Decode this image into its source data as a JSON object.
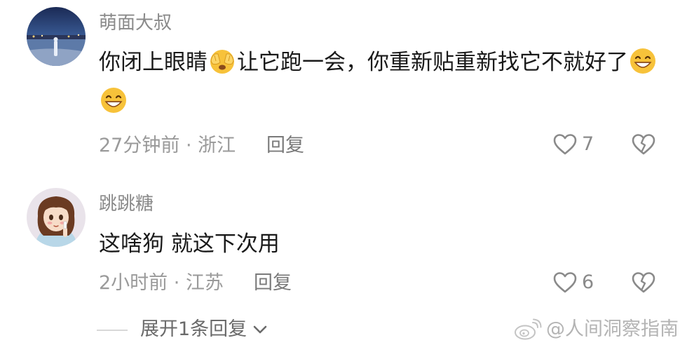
{
  "comments": [
    {
      "username": "萌面大叔",
      "text_part1": "你闭上眼睛",
      "text_part2": "让它跑一会，你重新贴重新找它不就好了",
      "time": "27分钟前",
      "separator": "·",
      "location": "浙江",
      "reply_label": "回复",
      "likes": "7",
      "avatar_icon": "night-city-avatar",
      "emojis": [
        "face-covering-eyes-emoji",
        "grinning-emoji",
        "grinning-emoji"
      ]
    },
    {
      "username": "跳跳糖",
      "text": "这啥狗 就这下次用",
      "time": "2小时前",
      "separator": "·",
      "location": "江苏",
      "reply_label": "回复",
      "likes": "6",
      "avatar_icon": "anime-girl-avatar"
    }
  ],
  "expand_replies_label": "展开1条回复",
  "watermark": "@人间洞察指南",
  "colors": {
    "username": "#8a8a8a",
    "text": "#1a1a1a",
    "meta": "#9a9a9a",
    "icon": "#8a8a8a",
    "emoji_face": "#f7c23a"
  }
}
